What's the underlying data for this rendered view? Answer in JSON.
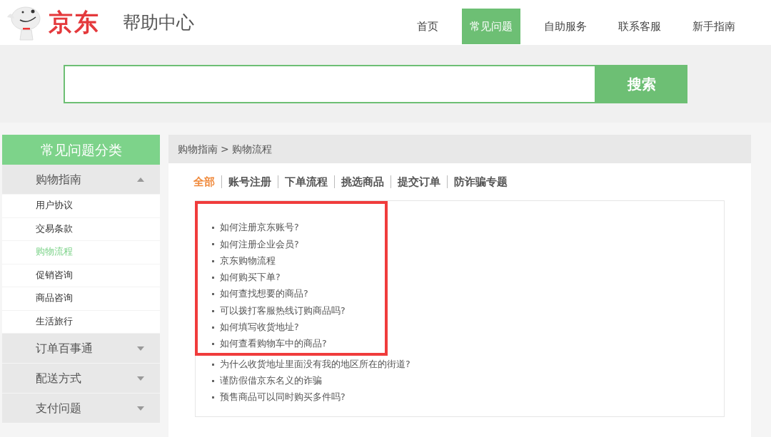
{
  "header": {
    "logo_text": "京东",
    "site_title": "帮助中心",
    "nav": [
      {
        "label": "首页",
        "selected": false
      },
      {
        "label": "常见问题",
        "selected": true
      },
      {
        "label": "自助服务",
        "selected": false
      },
      {
        "label": "联系客服",
        "selected": false
      },
      {
        "label": "新手指南",
        "selected": false
      }
    ]
  },
  "search": {
    "button": "搜索"
  },
  "sidebar": {
    "title": "常见问题分类",
    "sections": [
      {
        "label": "购物指南",
        "expanded": true,
        "children": [
          {
            "label": "用户协议",
            "selected": false
          },
          {
            "label": "交易条款",
            "selected": false
          },
          {
            "label": "购物流程",
            "selected": true
          },
          {
            "label": "促销咨询",
            "selected": false
          },
          {
            "label": "商品咨询",
            "selected": false
          },
          {
            "label": "生活旅行",
            "selected": false
          }
        ]
      },
      {
        "label": "订单百事通",
        "expanded": false
      },
      {
        "label": "配送方式",
        "expanded": false
      },
      {
        "label": "支付问题",
        "expanded": false
      }
    ]
  },
  "breadcrumb": [
    "购物指南",
    ">",
    "购物流程"
  ],
  "tabs": [
    {
      "label": "全部",
      "selected": true
    },
    {
      "label": "账号注册",
      "selected": false
    },
    {
      "label": "下单流程",
      "selected": false
    },
    {
      "label": "挑选商品",
      "selected": false
    },
    {
      "label": "提交订单",
      "selected": false
    },
    {
      "label": "防诈骗专题",
      "selected": false
    }
  ],
  "question_list": {
    "red_frame_questions": [
      {
        "text": "如何注册京东账号?"
      },
      {
        "text": "如何注册企业会员?"
      },
      {
        "text": "京东购物流程"
      },
      {
        "text": "如何购买下单?"
      },
      {
        "text": "如何查找想要的商品?"
      },
      {
        "text": "可以拨打客服热线订购商品吗?"
      },
      {
        "text": "如何填写收货地址?"
      },
      {
        "text": "如何查看购物车中的商品?"
      }
    ],
    "questions": [
      {
        "text": "为什么收货地址里面没有我的地区所在的街道?"
      },
      {
        "text": "谨防假借京东名义的诈骗"
      },
      {
        "text": "预售商品可以同时购买多件吗?"
      }
    ]
  }
}
